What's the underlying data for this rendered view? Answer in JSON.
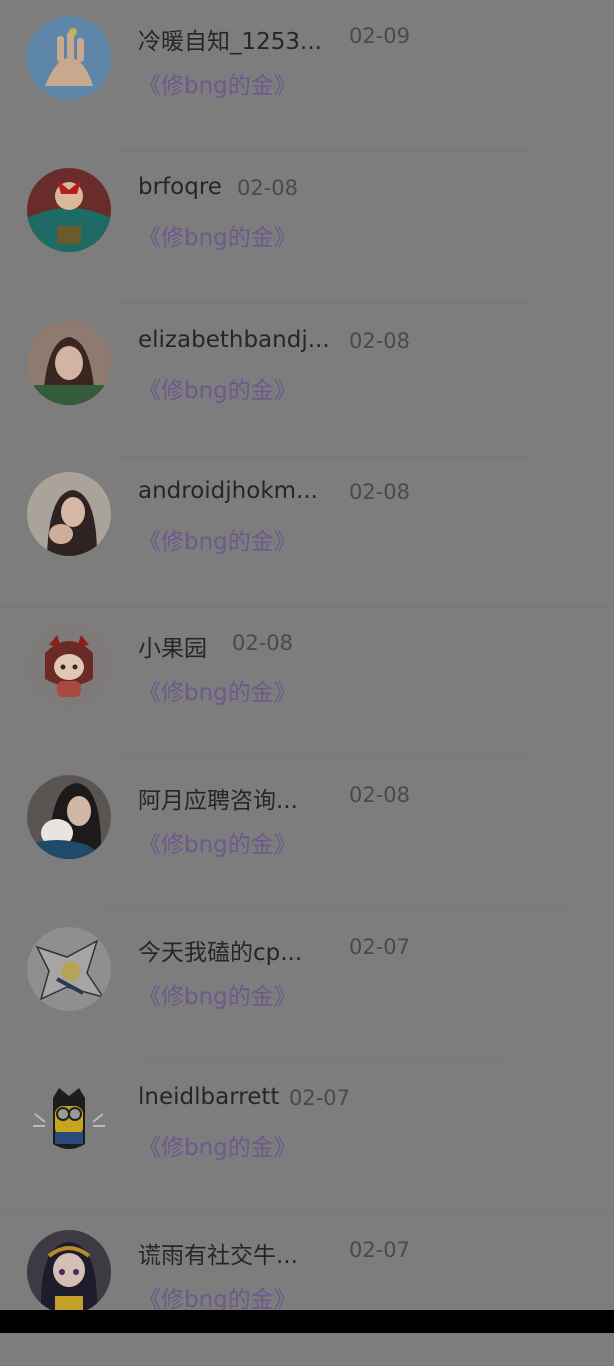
{
  "items": [
    {
      "name": "冷暖自知_1253...",
      "date": "02-09",
      "book": "《修bng的金》",
      "avatar": "avatar-hand"
    },
    {
      "name": "brfoqre",
      "date": "02-08",
      "book": "《修bng的金》",
      "avatar": "avatar-girl-red-bow"
    },
    {
      "name": "elizabethbandj...",
      "date": "02-08",
      "book": "《修bng的金》",
      "avatar": "avatar-girl-photo"
    },
    {
      "name": "androidjhokm...",
      "date": "02-08",
      "book": "《修bng的金》",
      "avatar": "avatar-couple-photo"
    },
    {
      "name": "小果园",
      "date": "02-08",
      "book": "《修bng的金》",
      "avatar": "avatar-cartoon-girl"
    },
    {
      "name": "阿月应聘咨询...",
      "date": "02-08",
      "book": "《修bng的金》",
      "avatar": "avatar-girl-cat"
    },
    {
      "name": "今天我磕的cp...",
      "date": "02-07",
      "book": "《修bng的金》",
      "avatar": "avatar-anime-sketch"
    },
    {
      "name": "lneidlbarrett",
      "date": "02-07",
      "book": "《修bng的金》",
      "avatar": "avatar-minion"
    },
    {
      "name": "谎雨有社交牛...",
      "date": "02-07",
      "book": "《修bng的金》",
      "avatar": "avatar-anime-girl"
    }
  ]
}
